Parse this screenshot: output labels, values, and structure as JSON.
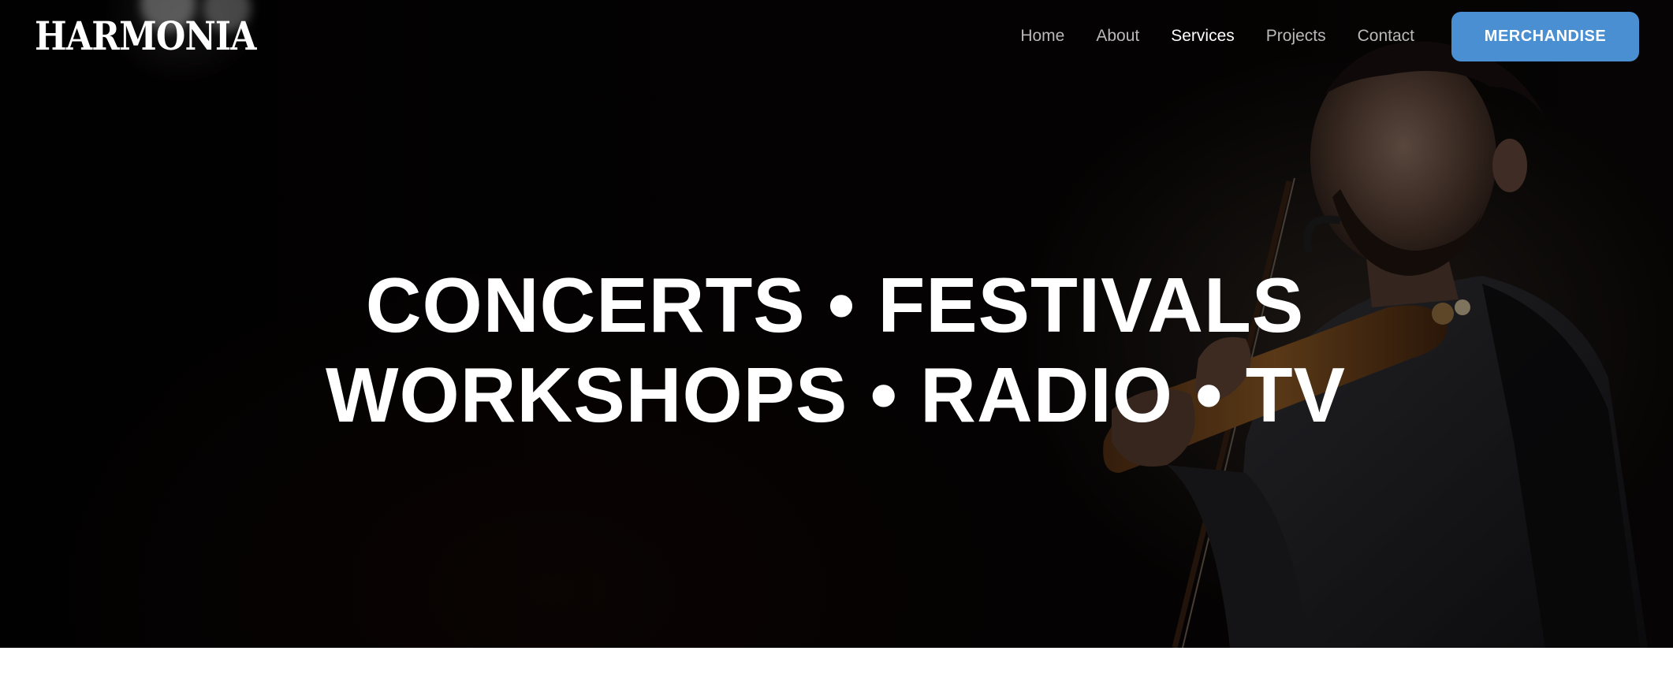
{
  "brand": {
    "logo_text": "HARMONIA"
  },
  "nav": {
    "links": [
      {
        "label": "Home",
        "active": false
      },
      {
        "label": "About",
        "active": false
      },
      {
        "label": "Services",
        "active": true
      },
      {
        "label": "Projects",
        "active": false
      },
      {
        "label": "Contact",
        "active": false
      }
    ],
    "cta_label": "MERCHANDISE"
  },
  "hero": {
    "line1": "CONCERTS • FESTIVALS",
    "line2": "WORKSHOPS • RADIO • TV",
    "image_subject": "violinist-performing-photo"
  },
  "colors": {
    "accent": "#4a8fd1",
    "hero_bg": "#050303",
    "text": "#ffffff",
    "nav_inactive": "#b9b9b9"
  }
}
